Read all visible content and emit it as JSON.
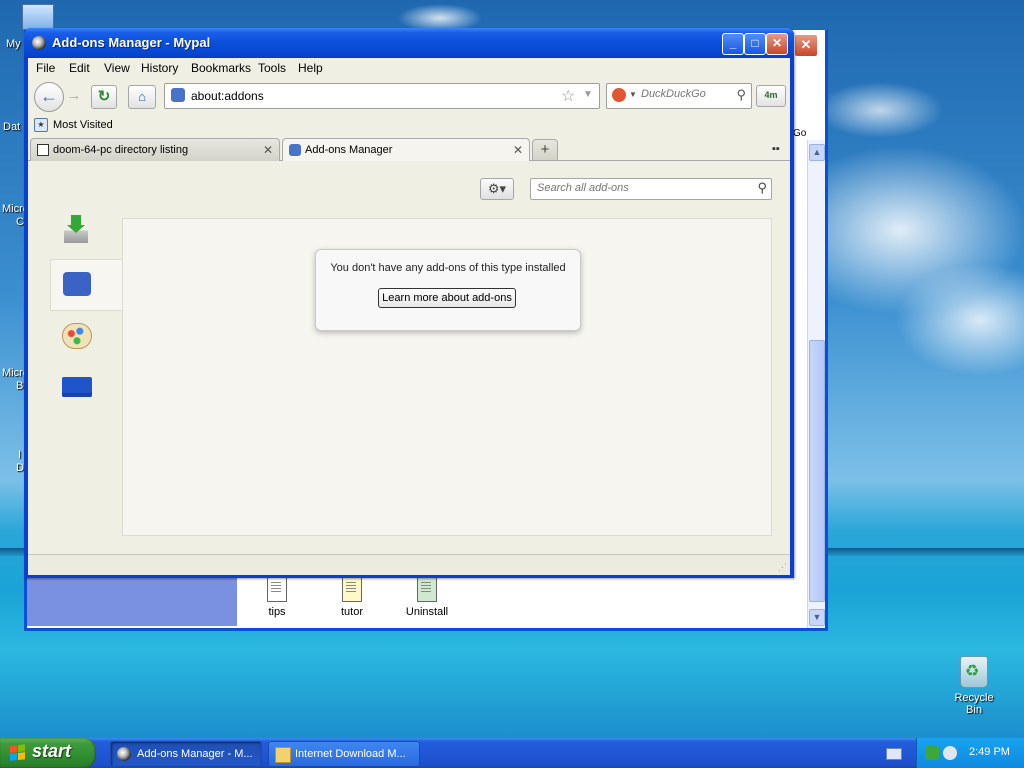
{
  "desktop": {
    "labels": [
      "My",
      "Dat",
      "Micro",
      "C",
      "Micro",
      "B",
      "I",
      "D"
    ],
    "recycle_bin": "Recycle Bin"
  },
  "bg_window": {
    "files": [
      "tips",
      "tutor",
      "Uninstall"
    ],
    "partial_text": "Go"
  },
  "window": {
    "title": "Add-ons Manager - Mypal",
    "menu": [
      "File",
      "Edit",
      "View",
      "History",
      "Bookmarks",
      "Tools",
      "Help"
    ],
    "url": "about:addons",
    "search_placeholder": "DuckDuckGo",
    "ext_label": "4m",
    "bookmark": "Most Visited",
    "tabs": [
      {
        "label": "doom-64-pc directory listing",
        "active": false
      },
      {
        "label": "Add-ons Manager",
        "active": true
      }
    ]
  },
  "addons": {
    "search_placeholder": "Search all add-ons",
    "categories": [
      "get-addons",
      "extensions",
      "appearance",
      "plugins"
    ],
    "selected_category": "extensions",
    "empty_message": "You don't have any add-ons of this type installed",
    "learn_more": "Learn more about add-ons"
  },
  "taskbar": {
    "start": "start",
    "tasks": [
      "Add-ons Manager - M...",
      "Internet Download M..."
    ],
    "clock": "2:49 PM"
  },
  "colors": {
    "title_blue": "#0a4fdc",
    "start_green": "#3c9a3c",
    "chrome_bg": "#f0efe4"
  }
}
